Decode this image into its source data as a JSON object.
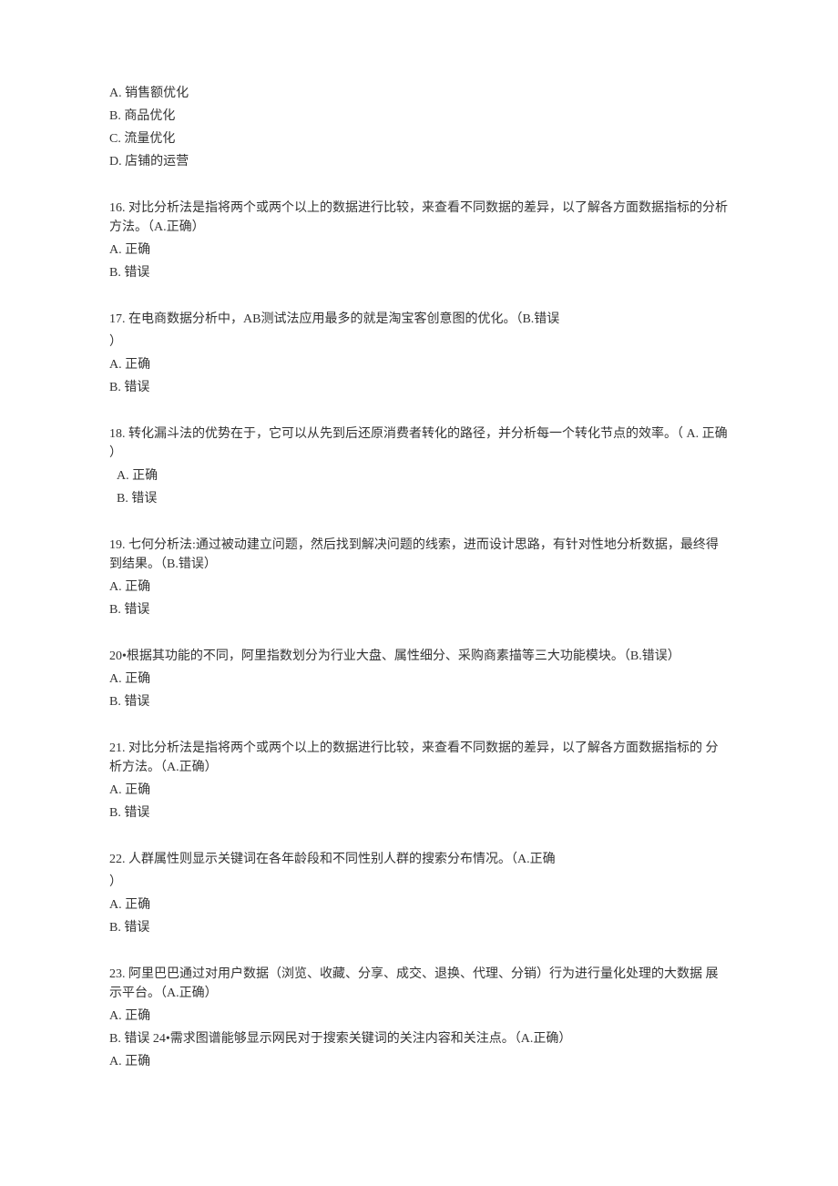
{
  "prefix_options": {
    "a": "A.  销售额优化",
    "b": "B.  商品优化",
    "c": "C.  流量优化",
    "d": "D.  店铺的运营"
  },
  "q16": {
    "stem": "16.  对比分析法是指将两个或两个以上的数据进行比较，来查看不同数据的差异，以了解各方面数据指标的分析方法。（A.正确）",
    "a": "A.  正确",
    "b": "B.  错误"
  },
  "q17": {
    "stem": "17.  在电商数据分析中，AB测试法应用最多的就是淘宝客创意图的优化。（B.错误",
    "stem2": "  ）",
    "a": "A.  正确",
    "b": "B.  错误"
  },
  "q18": {
    "stem": "18.  转化漏斗法的优势在于，它可以从先到后还原消费者转化的路径，并分析每一个转化节点的效率。（ A. 正确 ）",
    "a": "A.  正确",
    "b": "B.  错误"
  },
  "q19": {
    "stem": "19.  七何分析法:通过被动建立问题，然后找到解决问题的线索，进而设计思路，有针对性地分析数据，最终得到结果。（B.错误）",
    "a": "A.  正确",
    "b": "B.  错误"
  },
  "q20": {
    "stem": "20•根据其功能的不同，阿里指数划分为行业大盘、属性细分、采购商素描等三大功能模块。（B.错误）",
    "a": "A.  正确",
    "b": "B.  错误"
  },
  "q21": {
    "stem": "21.  对比分析法是指将两个或两个以上的数据进行比较，来查看不同数据的差异，以了解各方面数据指标的 分析方法。（A.正确）",
    "a": "A.  正确",
    "b": "B.  错误"
  },
  "q22": {
    "stem": "22.  人群属性则显示关键词在各年龄段和不同性别人群的搜索分布情况。（A.正确",
    "stem2": "  ）",
    "a": "A.  正确",
    "b": "B.  错误"
  },
  "q23": {
    "stem": "23.  阿里巴巴通过对用户数据（浏览、收藏、分享、成交、退换、代理、分销）行为进行量化处理的大数据 展示平台。（A.正确）",
    "a": "A.      正确",
    "b": "B.      错误 24•需求图谱能够显示网民对于搜索关键词的关注内容和关注点。（A.正确）",
    "a2": "A.  正确"
  }
}
